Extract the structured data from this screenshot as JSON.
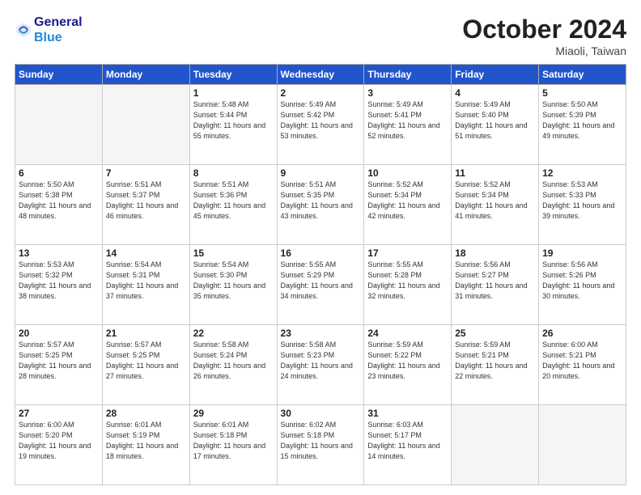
{
  "header": {
    "logo_line1": "General",
    "logo_line2": "Blue",
    "month": "October 2024",
    "location": "Miaoli, Taiwan"
  },
  "weekdays": [
    "Sunday",
    "Monday",
    "Tuesday",
    "Wednesday",
    "Thursday",
    "Friday",
    "Saturday"
  ],
  "weeks": [
    [
      {
        "day": "",
        "empty": true
      },
      {
        "day": "",
        "empty": true
      },
      {
        "day": "1",
        "sunrise": "5:48 AM",
        "sunset": "5:44 PM",
        "daylight": "11 hours and 55 minutes."
      },
      {
        "day": "2",
        "sunrise": "5:49 AM",
        "sunset": "5:42 PM",
        "daylight": "11 hours and 53 minutes."
      },
      {
        "day": "3",
        "sunrise": "5:49 AM",
        "sunset": "5:41 PM",
        "daylight": "11 hours and 52 minutes."
      },
      {
        "day": "4",
        "sunrise": "5:49 AM",
        "sunset": "5:40 PM",
        "daylight": "11 hours and 51 minutes."
      },
      {
        "day": "5",
        "sunrise": "5:50 AM",
        "sunset": "5:39 PM",
        "daylight": "11 hours and 49 minutes."
      }
    ],
    [
      {
        "day": "6",
        "sunrise": "5:50 AM",
        "sunset": "5:38 PM",
        "daylight": "11 hours and 48 minutes."
      },
      {
        "day": "7",
        "sunrise": "5:51 AM",
        "sunset": "5:37 PM",
        "daylight": "11 hours and 46 minutes."
      },
      {
        "day": "8",
        "sunrise": "5:51 AM",
        "sunset": "5:36 PM",
        "daylight": "11 hours and 45 minutes."
      },
      {
        "day": "9",
        "sunrise": "5:51 AM",
        "sunset": "5:35 PM",
        "daylight": "11 hours and 43 minutes."
      },
      {
        "day": "10",
        "sunrise": "5:52 AM",
        "sunset": "5:34 PM",
        "daylight": "11 hours and 42 minutes."
      },
      {
        "day": "11",
        "sunrise": "5:52 AM",
        "sunset": "5:34 PM",
        "daylight": "11 hours and 41 minutes."
      },
      {
        "day": "12",
        "sunrise": "5:53 AM",
        "sunset": "5:33 PM",
        "daylight": "11 hours and 39 minutes."
      }
    ],
    [
      {
        "day": "13",
        "sunrise": "5:53 AM",
        "sunset": "5:32 PM",
        "daylight": "11 hours and 38 minutes."
      },
      {
        "day": "14",
        "sunrise": "5:54 AM",
        "sunset": "5:31 PM",
        "daylight": "11 hours and 37 minutes."
      },
      {
        "day": "15",
        "sunrise": "5:54 AM",
        "sunset": "5:30 PM",
        "daylight": "11 hours and 35 minutes."
      },
      {
        "day": "16",
        "sunrise": "5:55 AM",
        "sunset": "5:29 PM",
        "daylight": "11 hours and 34 minutes."
      },
      {
        "day": "17",
        "sunrise": "5:55 AM",
        "sunset": "5:28 PM",
        "daylight": "11 hours and 32 minutes."
      },
      {
        "day": "18",
        "sunrise": "5:56 AM",
        "sunset": "5:27 PM",
        "daylight": "11 hours and 31 minutes."
      },
      {
        "day": "19",
        "sunrise": "5:56 AM",
        "sunset": "5:26 PM",
        "daylight": "11 hours and 30 minutes."
      }
    ],
    [
      {
        "day": "20",
        "sunrise": "5:57 AM",
        "sunset": "5:25 PM",
        "daylight": "11 hours and 28 minutes."
      },
      {
        "day": "21",
        "sunrise": "5:57 AM",
        "sunset": "5:25 PM",
        "daylight": "11 hours and 27 minutes."
      },
      {
        "day": "22",
        "sunrise": "5:58 AM",
        "sunset": "5:24 PM",
        "daylight": "11 hours and 26 minutes."
      },
      {
        "day": "23",
        "sunrise": "5:58 AM",
        "sunset": "5:23 PM",
        "daylight": "11 hours and 24 minutes."
      },
      {
        "day": "24",
        "sunrise": "5:59 AM",
        "sunset": "5:22 PM",
        "daylight": "11 hours and 23 minutes."
      },
      {
        "day": "25",
        "sunrise": "5:59 AM",
        "sunset": "5:21 PM",
        "daylight": "11 hours and 22 minutes."
      },
      {
        "day": "26",
        "sunrise": "6:00 AM",
        "sunset": "5:21 PM",
        "daylight": "11 hours and 20 minutes."
      }
    ],
    [
      {
        "day": "27",
        "sunrise": "6:00 AM",
        "sunset": "5:20 PM",
        "daylight": "11 hours and 19 minutes."
      },
      {
        "day": "28",
        "sunrise": "6:01 AM",
        "sunset": "5:19 PM",
        "daylight": "11 hours and 18 minutes."
      },
      {
        "day": "29",
        "sunrise": "6:01 AM",
        "sunset": "5:18 PM",
        "daylight": "11 hours and 17 minutes."
      },
      {
        "day": "30",
        "sunrise": "6:02 AM",
        "sunset": "5:18 PM",
        "daylight": "11 hours and 15 minutes."
      },
      {
        "day": "31",
        "sunrise": "6:03 AM",
        "sunset": "5:17 PM",
        "daylight": "11 hours and 14 minutes."
      },
      {
        "day": "",
        "empty": true
      },
      {
        "day": "",
        "empty": true
      }
    ]
  ]
}
